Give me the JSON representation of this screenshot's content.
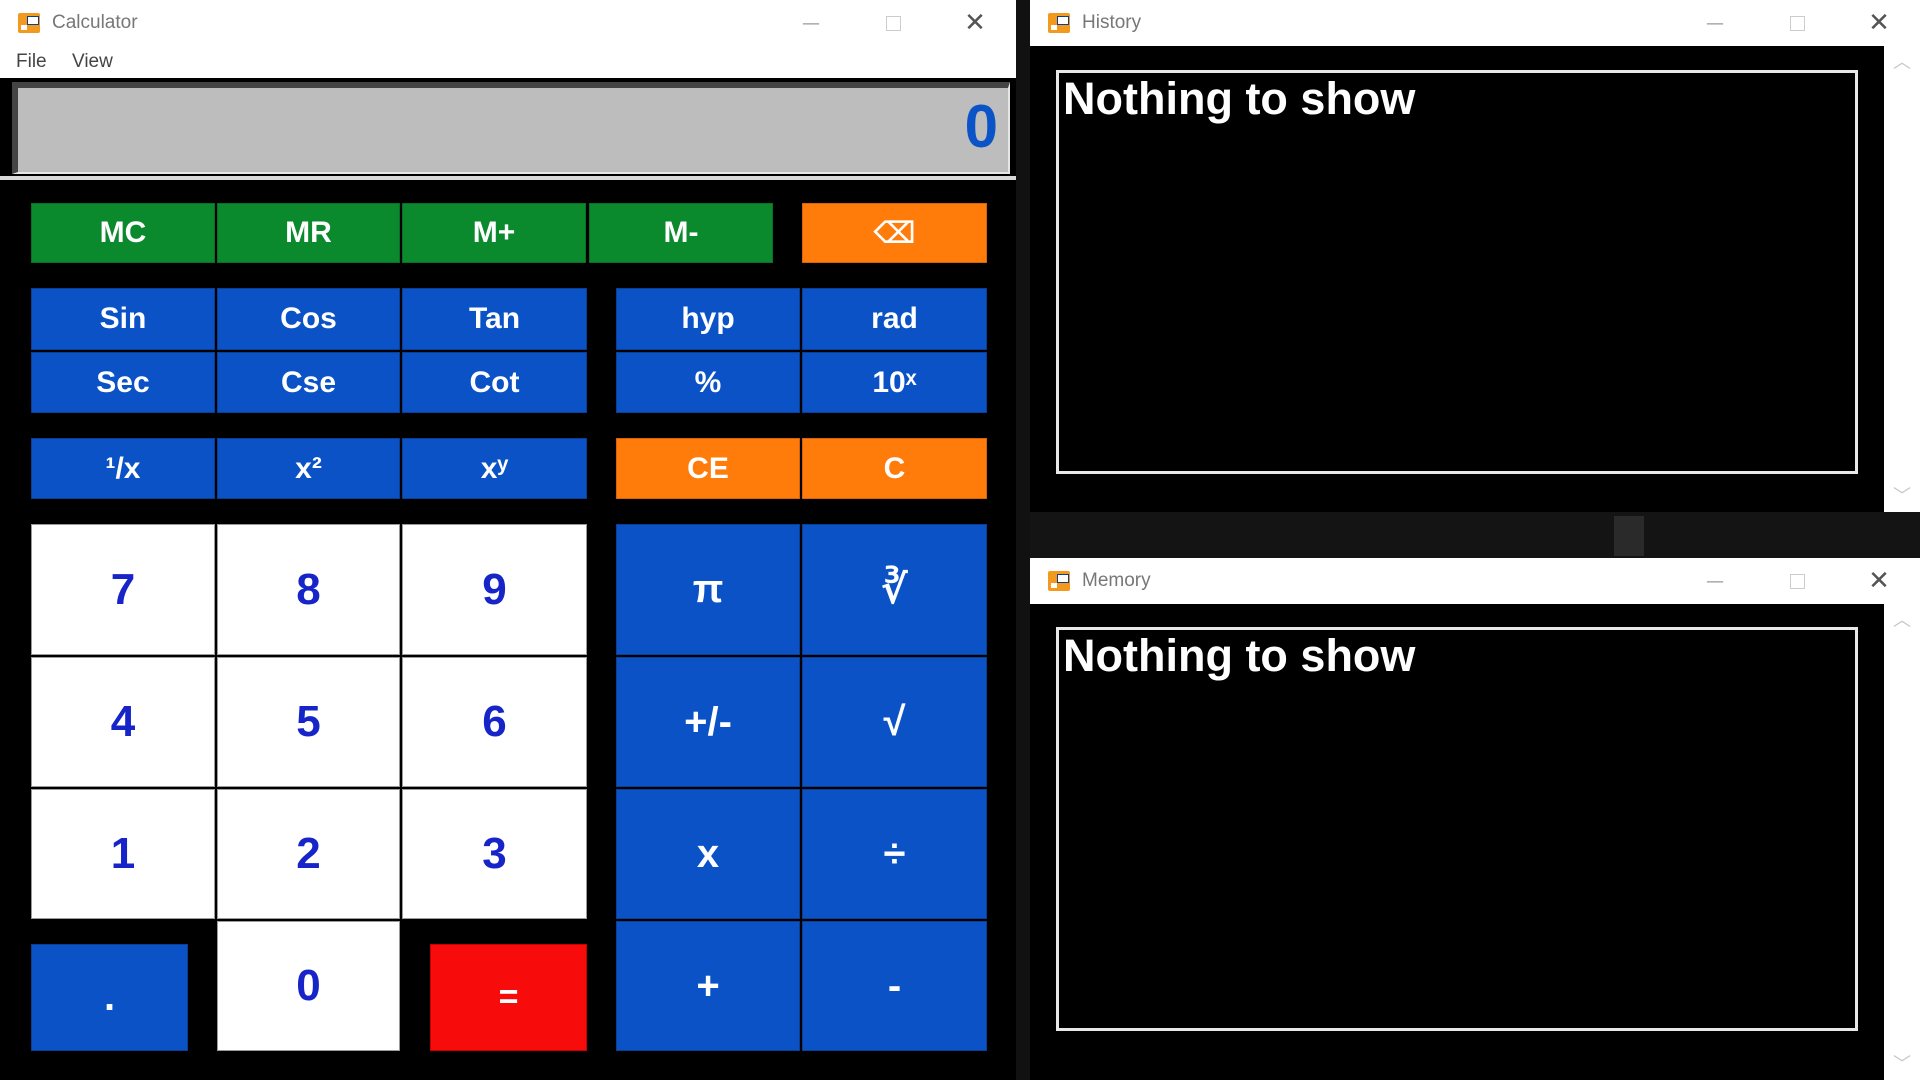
{
  "calculator": {
    "title": "Calculator",
    "menu": [
      "File",
      "View"
    ],
    "display_value": "0",
    "window_controls": {
      "minimize": "—",
      "close": "✕"
    },
    "memory_buttons": [
      "MC",
      "MR",
      "M+",
      "M-"
    ],
    "backspace": "⌫",
    "sci_row1": [
      "Sin",
      "Cos",
      "Tan"
    ],
    "sci_row2": [
      "Sec",
      "Cse",
      "Cot"
    ],
    "mode_row1": [
      "hyp",
      "rad"
    ],
    "mode_row2": [
      "%",
      "10ˣ"
    ],
    "power_row": [
      "¹/x",
      "x²",
      "xʸ"
    ],
    "clear_row": [
      "CE",
      "C"
    ],
    "digits": [
      "7",
      "8",
      "9",
      "4",
      "5",
      "6",
      "1",
      "2",
      "3"
    ],
    "dot": ".",
    "zero": "0",
    "equals": "=",
    "ops": [
      "π",
      "∛",
      "+/-",
      "√",
      "x",
      "÷",
      "+",
      "-"
    ]
  },
  "history": {
    "title": "History",
    "empty_text": "Nothing to show"
  },
  "memory": {
    "title": "Memory",
    "empty_text": "Nothing to show"
  },
  "colors": {
    "memory_green": "#0a8a2c",
    "function_blue": "#0a52c6",
    "clear_orange": "#ff7b0a",
    "equals_red": "#f70b0b",
    "digit_text_blue": "#1624c8",
    "display_text_blue": "#0a54c8"
  }
}
